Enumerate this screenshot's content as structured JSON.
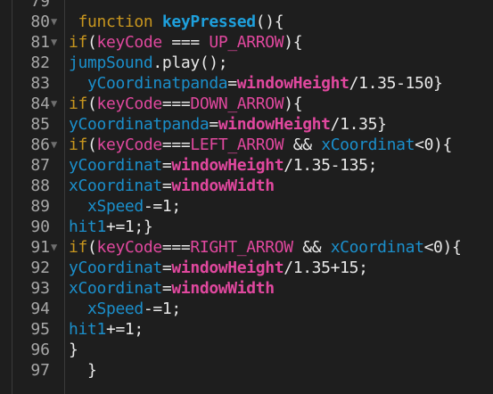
{
  "colors": {
    "background": "#1e1e1e",
    "keyword": "#c8961e",
    "function": "#1ea0dc",
    "variable": "#1b8fcb",
    "constant": "#e0489e",
    "plain": "#e8e8e8"
  },
  "lines": [
    {
      "num": "79",
      "fold": false,
      "tokens": []
    },
    {
      "num": "80",
      "fold": true,
      "tokens": [
        [
          "plain",
          " "
        ],
        [
          "kw",
          "function"
        ],
        [
          "plain",
          " "
        ],
        [
          "fn",
          "keyPressed"
        ],
        [
          "plain",
          "(){"
        ]
      ]
    },
    {
      "num": "81",
      "fold": true,
      "tokens": [
        [
          "kw",
          "if"
        ],
        [
          "plain",
          "("
        ],
        [
          "const",
          "keyCode"
        ],
        [
          "plain",
          " === "
        ],
        [
          "const",
          "UP_ARROW"
        ],
        [
          "plain",
          "){"
        ]
      ]
    },
    {
      "num": "82",
      "fold": false,
      "tokens": [
        [
          "var",
          "jumpSound"
        ],
        [
          "plain",
          ".play();"
        ]
      ]
    },
    {
      "num": "83",
      "fold": false,
      "tokens": [
        [
          "plain",
          "  "
        ],
        [
          "var",
          "yCoordinatpanda"
        ],
        [
          "plain",
          "="
        ],
        [
          "glob",
          "windowHeight"
        ],
        [
          "plain",
          "/1.35-150}"
        ]
      ]
    },
    {
      "num": "84",
      "fold": true,
      "tokens": [
        [
          "kw",
          "if"
        ],
        [
          "plain",
          "("
        ],
        [
          "const",
          "keyCode"
        ],
        [
          "plain",
          "==="
        ],
        [
          "const",
          "DOWN_ARROW"
        ],
        [
          "plain",
          "){"
        ]
      ]
    },
    {
      "num": "85",
      "fold": false,
      "tokens": [
        [
          "var",
          "yCoordinatpanda"
        ],
        [
          "plain",
          "="
        ],
        [
          "glob",
          "windowHeight"
        ],
        [
          "plain",
          "/1.35}"
        ]
      ]
    },
    {
      "num": "86",
      "fold": true,
      "tokens": [
        [
          "kw",
          "if"
        ],
        [
          "plain",
          "("
        ],
        [
          "const",
          "keyCode"
        ],
        [
          "plain",
          "==="
        ],
        [
          "const",
          "LEFT_ARROW"
        ],
        [
          "plain",
          " && "
        ],
        [
          "var",
          "xCoordinat"
        ],
        [
          "plain",
          "<0){"
        ]
      ]
    },
    {
      "num": "87",
      "fold": false,
      "tokens": [
        [
          "var",
          "yCoordinat"
        ],
        [
          "plain",
          "="
        ],
        [
          "glob",
          "windowHeight"
        ],
        [
          "plain",
          "/1.35-135;"
        ]
      ]
    },
    {
      "num": "88",
      "fold": false,
      "tokens": [
        [
          "var",
          "xCoordinat"
        ],
        [
          "plain",
          "="
        ],
        [
          "glob",
          "windowWidth"
        ]
      ]
    },
    {
      "num": "89",
      "fold": false,
      "tokens": [
        [
          "plain",
          "  "
        ],
        [
          "var",
          "xSpeed"
        ],
        [
          "plain",
          "-=1;"
        ]
      ]
    },
    {
      "num": "90",
      "fold": false,
      "tokens": [
        [
          "var",
          "hit1"
        ],
        [
          "plain",
          "+=1;}"
        ]
      ]
    },
    {
      "num": "91",
      "fold": true,
      "tokens": [
        [
          "kw",
          "if"
        ],
        [
          "plain",
          "("
        ],
        [
          "const",
          "keyCode"
        ],
        [
          "plain",
          "==="
        ],
        [
          "const",
          "RIGHT_ARROW"
        ],
        [
          "plain",
          " && "
        ],
        [
          "var",
          "xCoordinat"
        ],
        [
          "plain",
          "<0){"
        ]
      ]
    },
    {
      "num": "92",
      "fold": false,
      "tokens": [
        [
          "var",
          "yCoordinat"
        ],
        [
          "plain",
          "="
        ],
        [
          "glob",
          "windowHeight"
        ],
        [
          "plain",
          "/1.35+15;"
        ]
      ]
    },
    {
      "num": "93",
      "fold": false,
      "tokens": [
        [
          "var",
          "xCoordinat"
        ],
        [
          "plain",
          "="
        ],
        [
          "glob",
          "windowWidth"
        ]
      ]
    },
    {
      "num": "94",
      "fold": false,
      "tokens": [
        [
          "plain",
          "  "
        ],
        [
          "var",
          "xSpeed"
        ],
        [
          "plain",
          "-=1;"
        ]
      ]
    },
    {
      "num": "95",
      "fold": false,
      "tokens": [
        [
          "var",
          "hit1"
        ],
        [
          "plain",
          "+=1;"
        ]
      ]
    },
    {
      "num": "96",
      "fold": false,
      "tokens": [
        [
          "plain",
          "}"
        ]
      ]
    },
    {
      "num": "97",
      "fold": false,
      "tokens": [
        [
          "plain",
          "  }"
        ]
      ]
    }
  ]
}
